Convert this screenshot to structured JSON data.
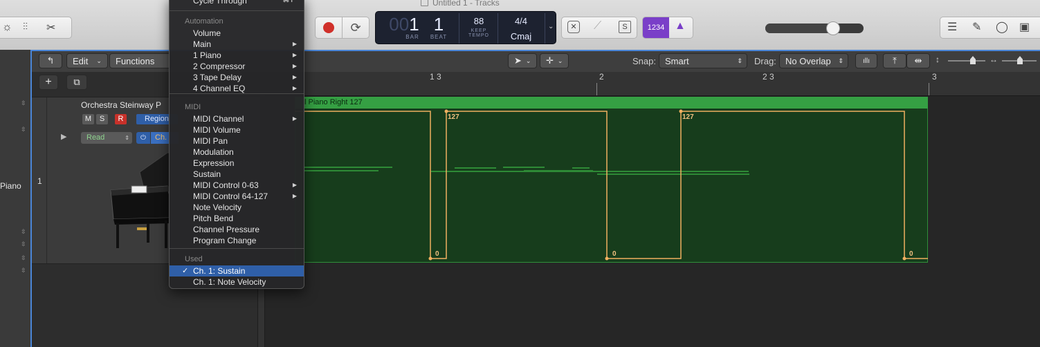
{
  "window": {
    "title": "Untitled 1 - Tracks"
  },
  "lcd": {
    "bar_dim": "00",
    "bar": "1",
    "beat": "1",
    "bar_label": "BAR",
    "beat_label": "BEAT",
    "tempo": "88",
    "keep": "KEEP",
    "tempo_label": "TEMPO",
    "signature": "4/4",
    "key": "Cmaj"
  },
  "count_in": "1234",
  "toolbar": {
    "edit": "Edit",
    "functions": "Functions",
    "snap_label": "Snap:",
    "snap_value": "Smart",
    "drag_label": "Drag:",
    "drag_value": "No Overlap"
  },
  "ruler": {
    "m1_3": "1 3",
    "m2": "2",
    "m2_3": "2 3",
    "m3": "3"
  },
  "track": {
    "number": "1",
    "name": "Orchestra Steinway P",
    "left_name": "Piano",
    "m": "M",
    "s": "S",
    "r": "R",
    "region_btn": "Region",
    "read": "Read",
    "channel": "Ch."
  },
  "region": {
    "name": "l Piano Right 127",
    "value_high_1": "127",
    "value_high_2": "127",
    "value_low_1": "0",
    "value_low_2": "0",
    "value_low_3": "0"
  },
  "menu": {
    "top_item": "Cycle Through",
    "top_shortcut": "⌘Y",
    "automation_header": "Automation",
    "automation": [
      "Volume",
      "Main",
      "1 Piano",
      "2 Compressor",
      "3 Tape Delay",
      "4 Channel EQ"
    ],
    "midi_header": "MIDI",
    "midi": [
      "MIDI Channel",
      "MIDI Volume",
      "MIDI Pan",
      "Modulation",
      "Expression",
      "Sustain",
      "MIDI Control 0-63",
      "MIDI Control 64-127",
      "Note Velocity",
      "Pitch Bend",
      "Channel Pressure",
      "Program Change"
    ],
    "used_header": "Used",
    "used": [
      "Ch. 1: Sustain",
      "Ch. 1: Note Velocity"
    ],
    "checkmark": "✓"
  },
  "colors": {
    "accent": "#2f5fa8",
    "region_green": "#35a043",
    "automation_line": "#f0b060",
    "record_red": "#d0302a"
  }
}
